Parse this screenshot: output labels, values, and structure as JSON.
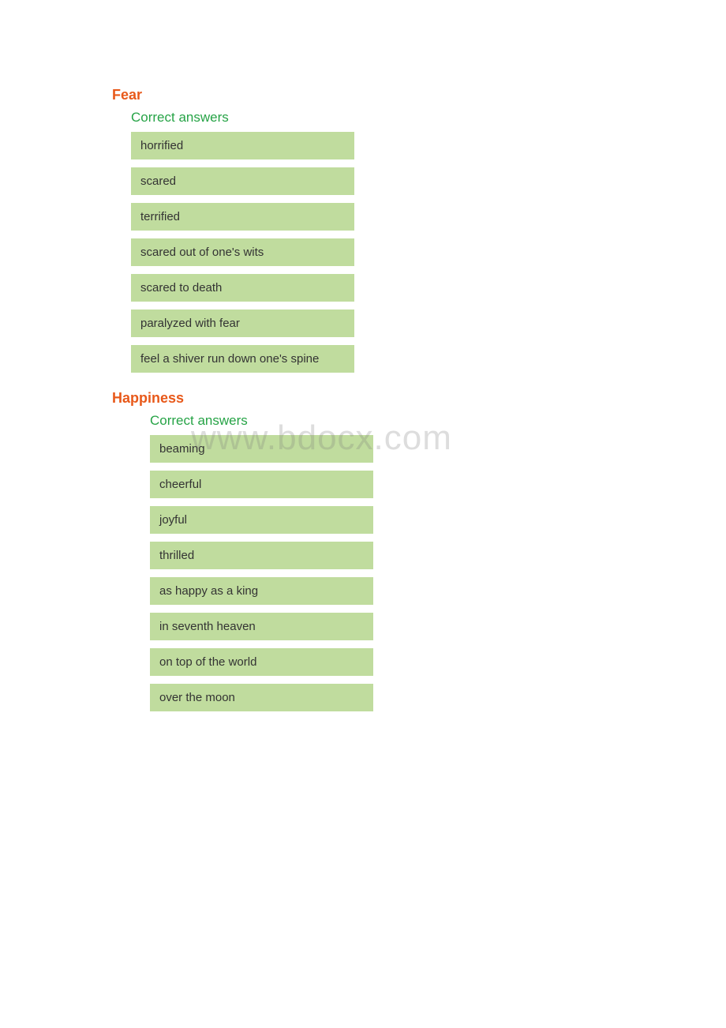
{
  "watermark": "www.bdocx.com",
  "sections": [
    {
      "title": "Fear",
      "subtitle": "Correct answers",
      "items": [
        "horrified",
        "scared",
        "terrified",
        "scared out of one's wits",
        "scared to death",
        "paralyzed with fear",
        "feel a shiver run down one's spine"
      ]
    },
    {
      "title": "Happiness",
      "subtitle": "Correct answers",
      "items": [
        "beaming",
        "cheerful",
        "joyful",
        "thrilled",
        "as happy as a king",
        "in seventh heaven",
        "on top of the world",
        "over the moon"
      ]
    }
  ]
}
